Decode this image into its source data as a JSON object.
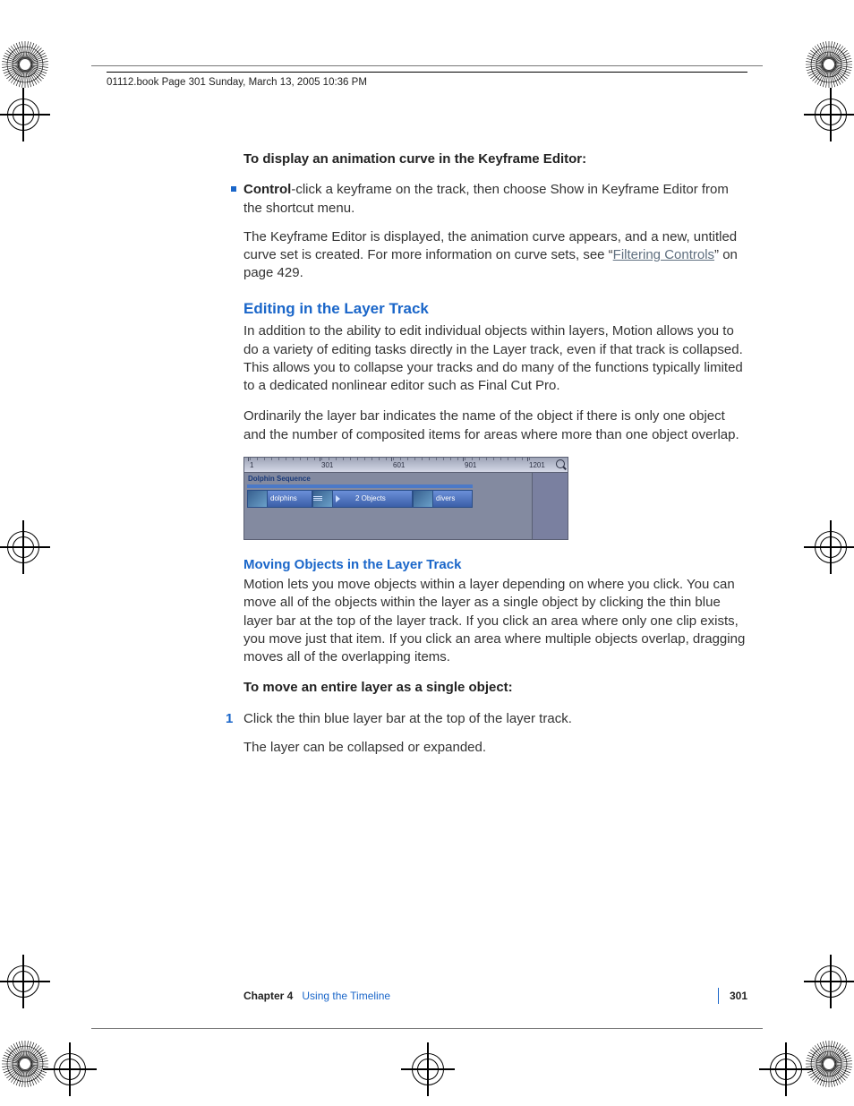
{
  "header": {
    "text": "01112.book  Page 301  Sunday, March 13, 2005  10:36 PM"
  },
  "section1": {
    "heading": "To display an animation curve in the Keyframe Editor:",
    "bullet_bold": "Control",
    "bullet_rest": "-click a keyframe on the track, then choose Show in Keyframe Editor from the shortcut menu.",
    "para1a": "The Keyframe Editor is displayed, the animation curve appears, and a new, untitled curve set is created. For more information on curve sets, see “",
    "link": "Filtering Controls",
    "para1b": "” on page 429."
  },
  "section2": {
    "h2": "Editing in the Layer Track",
    "para1": "In addition to the ability to edit individual objects within layers, Motion allows you to do a variety of editing tasks directly in the Layer track, even if that track is collapsed. This allows you to collapse your tracks and do many of the functions typically limited to a dedicated nonlinear editor such as Final Cut Pro.",
    "para2": "Ordinarily the layer bar indicates the name of the object if there is only one object and the number of composited items for areas where more than one object overlap."
  },
  "screenshot": {
    "ticks": [
      "1",
      "301",
      "601",
      "901",
      "1201"
    ],
    "layer_title": "Dolphin Sequence",
    "clip1": "dolphins",
    "clip2": "2 Objects",
    "clip3": "divers"
  },
  "section3": {
    "h3": "Moving Objects in the Layer Track",
    "para1": "Motion lets you move objects within a layer depending on where you click. You can move all of the objects within the layer as a single object by clicking the thin blue layer bar at the top of the layer track. If you click an area where only one clip exists, you move just that item. If you click an area where multiple objects overlap, dragging moves all of the overlapping items.",
    "heading": "To move an entire layer as a single object:",
    "step1": "Click the thin blue layer bar at the top of the layer track.",
    "para2": "The layer can be collapsed or expanded."
  },
  "footer": {
    "chapter": "Chapter 4",
    "title": "Using the Timeline",
    "page": "301"
  }
}
